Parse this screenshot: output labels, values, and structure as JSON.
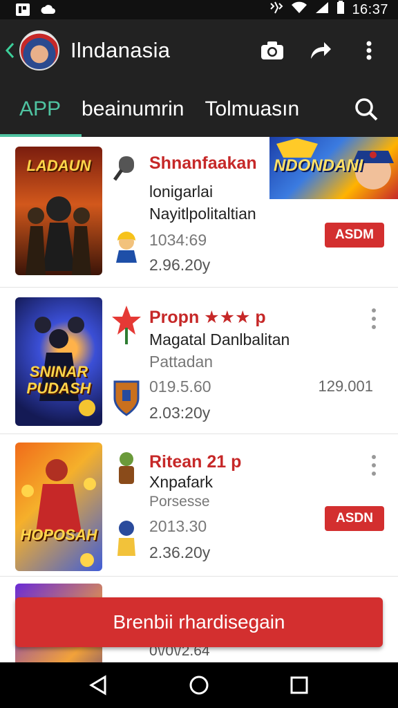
{
  "status_bar": {
    "time": "16:37"
  },
  "app_bar": {
    "title": "Ilndanasia"
  },
  "tabs": [
    {
      "label": "APP",
      "active": true
    },
    {
      "label": "beainumrin",
      "active": false
    },
    {
      "label": "Tolmuasın",
      "active": false
    }
  ],
  "banner": {
    "text": "NDONDANI"
  },
  "items": [
    {
      "thumb_text": "LADAUN",
      "title": "Shnanfaakan",
      "line1": "lonigarlai",
      "line2": "Nayitlpolitaltian",
      "line3": "1034:69",
      "line4": "2.96.20y",
      "button": "ASDM"
    },
    {
      "thumb_text": "SNINAR PUDASH",
      "title": "Propn ★★★ p",
      "line1": "Magatal Danlbalitan",
      "line2": "Pattadan",
      "line3": "019.5.60",
      "line4": "2.03:20y",
      "right_value": "129.001"
    },
    {
      "thumb_text": "HOPOSAH",
      "title": "Ritean 21 p",
      "line1": "Xnpafark",
      "line2": "Porsesse",
      "line3": "2013.30",
      "line4": "2.36.20y",
      "button": "ASDN"
    },
    {
      "line4": "0\\/0\\/2.64"
    }
  ],
  "cta": {
    "label": "Brenbii rhardisegain"
  },
  "colors": {
    "accent": "#4fc3a1",
    "brand_red": "#d32f2f",
    "title_red": "#c62828"
  }
}
